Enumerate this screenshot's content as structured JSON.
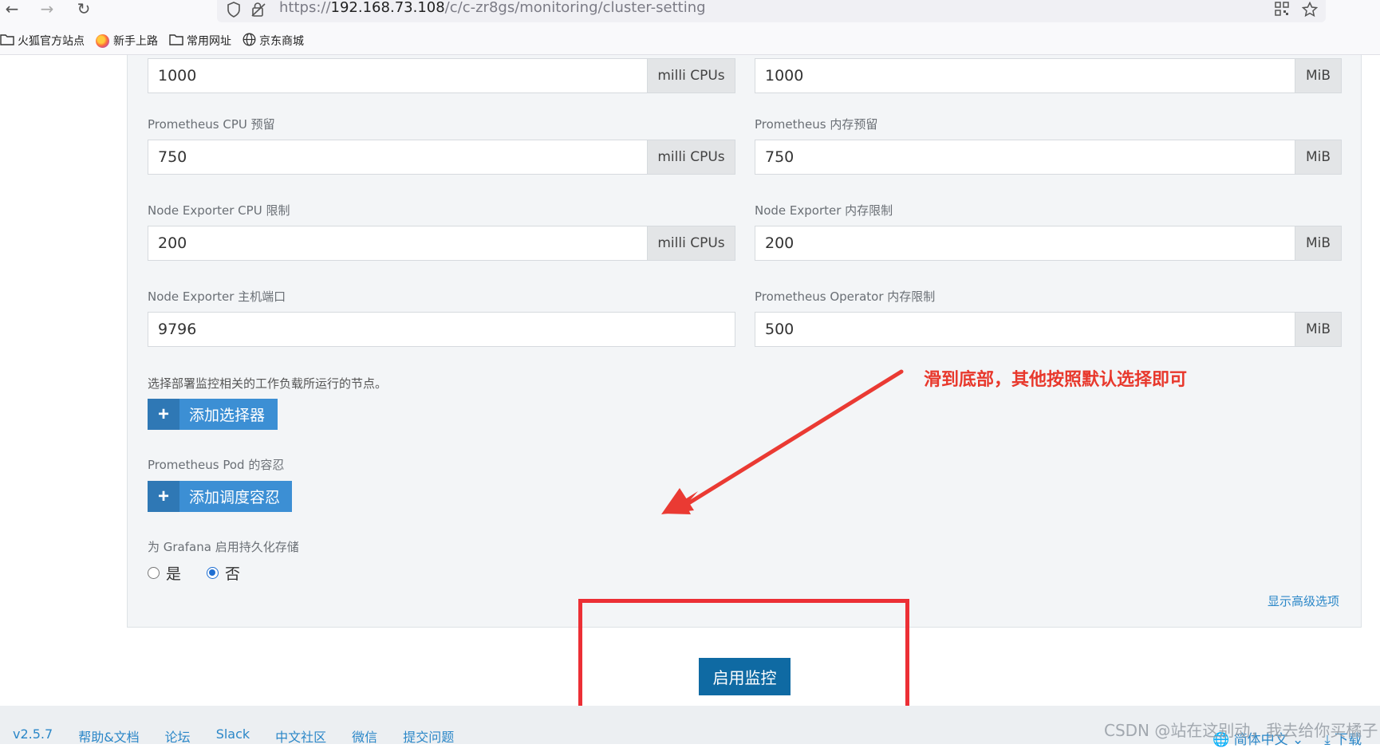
{
  "browser": {
    "url_prefix": "https://",
    "url_host": "192.168.73.108",
    "url_path": "/c/c-zr8gs/monitoring/cluster-setting",
    "bookmarks": [
      {
        "label": "火狐官方站点",
        "icon": "folder-icon"
      },
      {
        "label": "新手上路",
        "icon": "firefox-icon"
      },
      {
        "label": "常用网址",
        "icon": "folder-icon"
      },
      {
        "label": "京东商城",
        "icon": "globe-icon"
      }
    ]
  },
  "form": {
    "top_left": {
      "value": "1000",
      "unit": "milli CPUs"
    },
    "top_right": {
      "value": "1000",
      "unit": "MiB"
    },
    "prom_cpu_reserve": {
      "label": "Prometheus CPU 预留",
      "value": "750",
      "unit": "milli CPUs"
    },
    "prom_mem_reserve": {
      "label": "Prometheus 内存预留",
      "value": "750",
      "unit": "MiB"
    },
    "ne_cpu_limit": {
      "label": "Node Exporter CPU 限制",
      "value": "200",
      "unit": "milli CPUs"
    },
    "ne_mem_limit": {
      "label": "Node Exporter 内存限制",
      "value": "200",
      "unit": "MiB"
    },
    "ne_host_port": {
      "label": "Node Exporter 主机端口",
      "value": "9796"
    },
    "po_mem_limit": {
      "label": "Prometheus Operator 内存限制",
      "value": "500",
      "unit": "MiB"
    },
    "selector_help": "选择部署监控相关的工作负载所运行的节点。",
    "add_selector": "添加选择器",
    "tolerations_label": "Prometheus Pod 的容忍",
    "add_toleration": "添加调度容忍",
    "grafana_persist_label": "为 Grafana 启用持久化存储",
    "radio_yes": "是",
    "radio_no": "否",
    "selected_option": "否",
    "advanced_link": "显示高级选项"
  },
  "annotation": {
    "text": "滑到底部，其他按照默认选择即可",
    "color": "#e8382c"
  },
  "actions": {
    "enable_monitoring": "启用监控"
  },
  "footer": {
    "version": "v2.5.7",
    "links": [
      "帮助&文档",
      "论坛",
      "Slack",
      "中文社区",
      "微信",
      "提交问题"
    ],
    "language": "简体中文",
    "download": "下载"
  },
  "watermark": "CSDN @站在这别动，我去给你买橘子"
}
